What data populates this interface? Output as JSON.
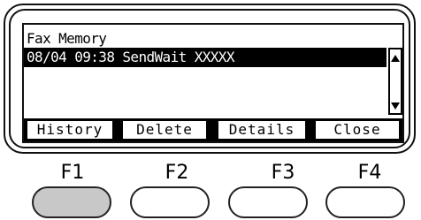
{
  "screen": {
    "title": "Fax Memory",
    "rows": [
      {
        "text": "08/04 09:38 SendWait XXXXX",
        "selected": true
      }
    ]
  },
  "softkeys": [
    {
      "label": "History"
    },
    {
      "label": "Delete"
    },
    {
      "label": "Details"
    },
    {
      "label": "Close"
    }
  ],
  "function_keys": [
    {
      "label": "F1",
      "pressed": true
    },
    {
      "label": "F2",
      "pressed": false
    },
    {
      "label": "F3",
      "pressed": false
    },
    {
      "label": "F4",
      "pressed": false
    }
  ],
  "colors": {
    "pressed_key": "#c8c8c8",
    "lcd_text": "#000000",
    "highlight": "#000000"
  }
}
